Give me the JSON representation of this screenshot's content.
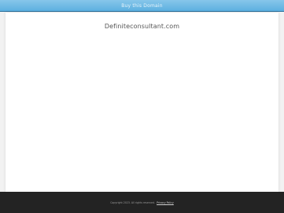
{
  "header": {
    "buy_link_label": "Buy this Domain"
  },
  "main": {
    "domain_name": "Definiteconsultant.com"
  },
  "footer": {
    "copyright_text": "Copyright 2023. All rights reserved.",
    "privacy_label": "Privacy Policy"
  }
}
